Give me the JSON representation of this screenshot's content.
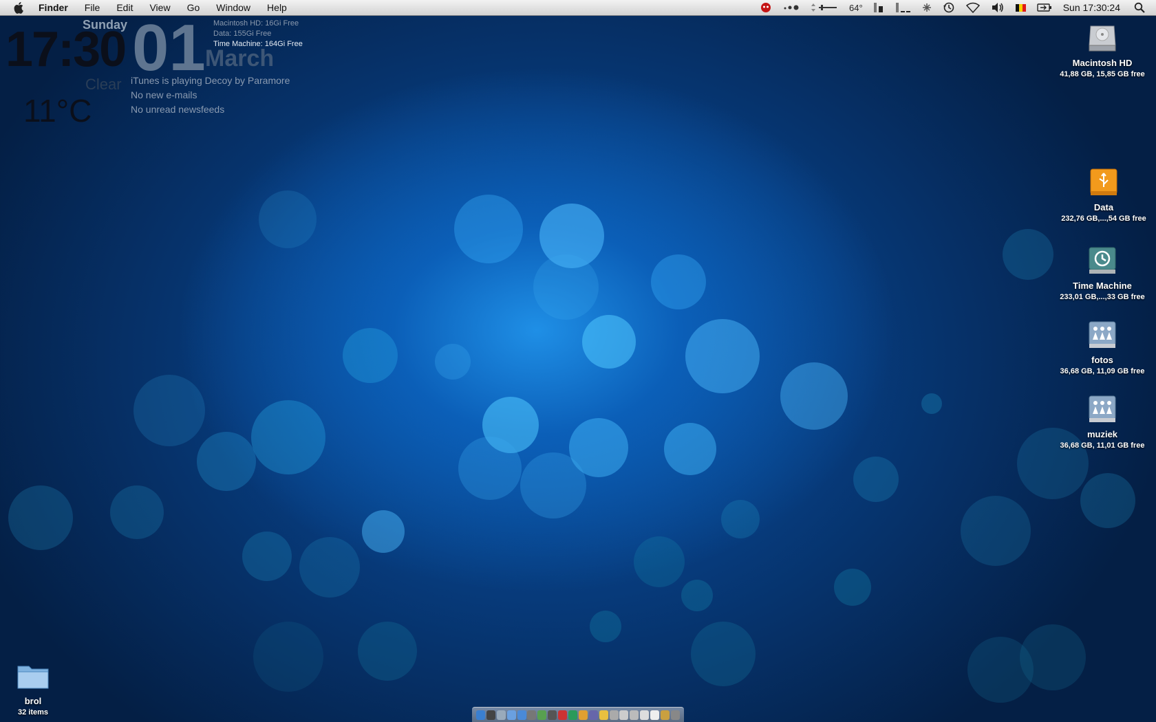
{
  "menubar": {
    "app_name": "Finder",
    "menus": [
      "File",
      "Edit",
      "View",
      "Go",
      "Window",
      "Help"
    ],
    "temperature": "64°",
    "clock": "Sun 17:30:24"
  },
  "widget": {
    "time": "17:30",
    "day": "Sunday",
    "date": "01",
    "month": "March",
    "weather": "Clear",
    "temperature": "11°C",
    "disks": [
      "Macintosh HD: 16Gi Free",
      "Data: 155Gi Free",
      "Time Machine: 164Gi Free"
    ],
    "itunes": "iTunes is playing Decoy by Paramore",
    "mail": "No new e-mails",
    "news": "No unread newsfeeds"
  },
  "desktop_icons": [
    {
      "name": "Macintosh HD",
      "sub": "41,88 GB, 15,85 GB free",
      "icon": "hard-drive-icon"
    },
    {
      "name": "Data",
      "sub": "232,76 GB,...,54 GB free",
      "icon": "usb-drive-icon"
    },
    {
      "name": "Time Machine",
      "sub": "233,01 GB,...,33 GB free",
      "icon": "time-machine-icon"
    },
    {
      "name": "fotos",
      "sub": "36,68 GB, 11,09 GB free",
      "icon": "network-share-icon"
    },
    {
      "name": "muziek",
      "sub": "36,68 GB, 11,01 GB free",
      "icon": "network-share-icon"
    },
    {
      "name": "brol",
      "sub": "32 items",
      "icon": "folder-icon"
    }
  ],
  "dock_colors": [
    "#3a7fd0",
    "#444",
    "#9ab",
    "#6aa0e0",
    "#4a8ad8",
    "#777",
    "#58a050",
    "#555",
    "#c33",
    "#2a9a5a",
    "#e0a030",
    "#66a",
    "#e8c040",
    "#aaa",
    "#ccc",
    "#bbb",
    "#ddd",
    "#eee",
    "#c9a040",
    "#888"
  ]
}
